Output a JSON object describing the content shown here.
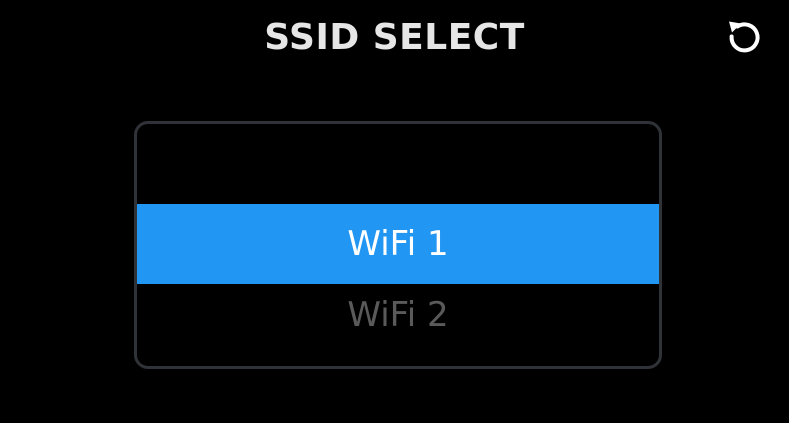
{
  "header": {
    "title": "SSID SELECT",
    "back_icon": "rotate-back-icon"
  },
  "ssid_list": {
    "items": [
      {
        "label": ""
      },
      {
        "label": "WiFi 1",
        "state": "selected"
      },
      {
        "label": "WiFi 2",
        "state": "unselected"
      }
    ],
    "selected_index": 1
  },
  "colors": {
    "background": "#000000",
    "title": "#e6e6e6",
    "selected_bg": "#2196f3",
    "selected_text": "#ffffff",
    "unselected_text": "#5a5a5a",
    "border": "#2f3236"
  }
}
